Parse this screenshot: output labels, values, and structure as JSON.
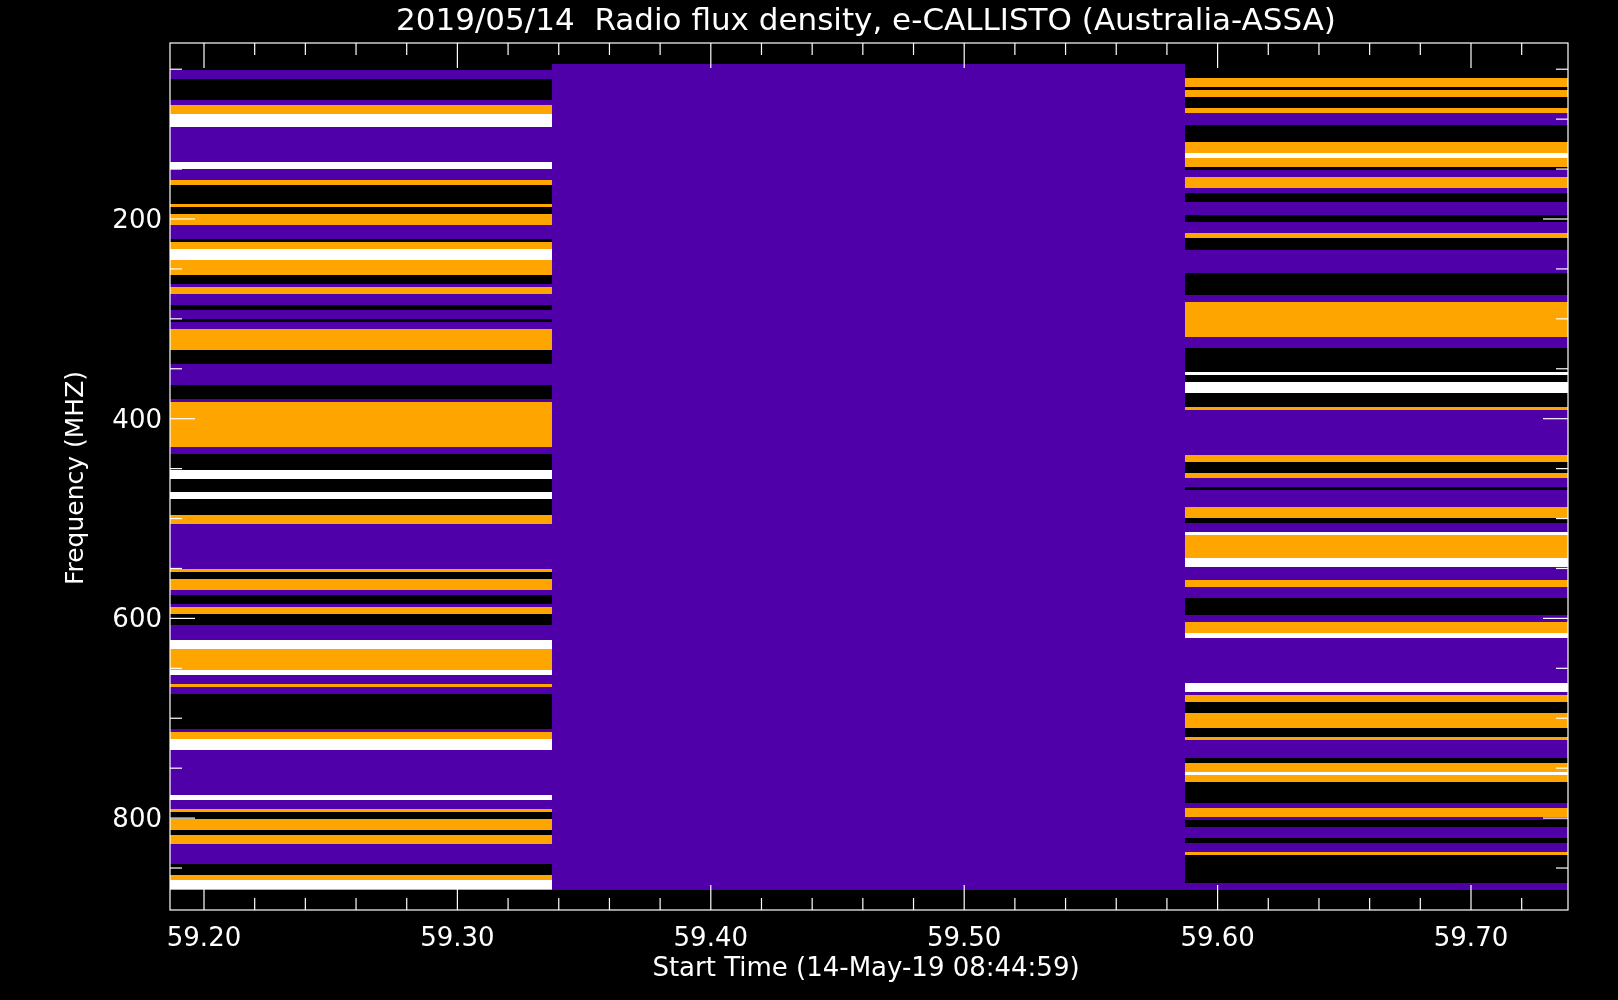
{
  "plot": {
    "title": "2019/05/14  Radio flux density, e-CALLISTO (Australia-ASSA)",
    "xlabel": "Start Time (14-May-19 08:44:59)",
    "ylabel": "Frequency (MHZ)",
    "xticks": [
      "59.20",
      "59.30",
      "59.40",
      "59.50",
      "59.60",
      "59.70"
    ],
    "yticks": [
      "200",
      "400",
      "600",
      "800"
    ]
  }
}
